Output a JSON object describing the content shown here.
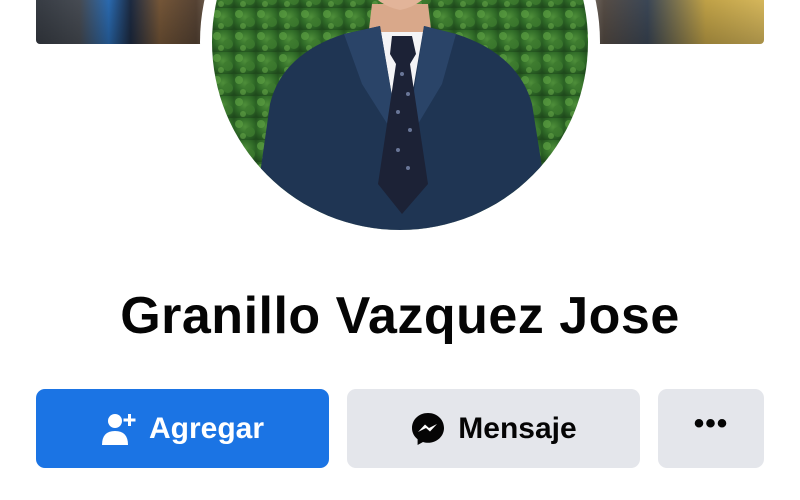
{
  "profile": {
    "name": "Granillo Vazquez Jose"
  },
  "actions": {
    "add_friend_label": "Agregar",
    "message_label": "Mensaje",
    "more_label": "•••"
  },
  "icons": {
    "add_friend": "add-friend-icon",
    "messenger": "messenger-icon",
    "more": "more-options-icon"
  },
  "colors": {
    "primary_button": "#1b74e4",
    "secondary_button": "#e4e6eb",
    "text": "#050505"
  }
}
